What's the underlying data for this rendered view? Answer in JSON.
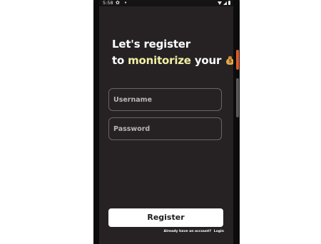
{
  "status_bar": {
    "time": "5:58",
    "icons": [
      "settings-icon",
      "dot-icon",
      "wifi-icon",
      "signal-icon",
      "battery-icon"
    ]
  },
  "heading": {
    "line1": "Let's register",
    "line2_prefix": "to ",
    "line2_accent": "monitorize",
    "line2_suffix": " your",
    "emoji_icon": "money-bag-icon",
    "accent_color": "#f3f0a6"
  },
  "form": {
    "username_placeholder": "Username",
    "password_placeholder": "Password"
  },
  "register_button": {
    "label": "Register"
  },
  "footer": {
    "text": "Already have an account?",
    "login_label": "Login"
  },
  "colors": {
    "background": "#262223",
    "button_bg": "#ffffff",
    "field_border": "#6a6667"
  }
}
